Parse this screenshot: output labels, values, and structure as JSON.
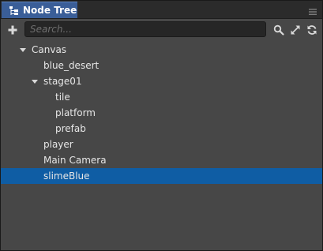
{
  "panel": {
    "tab_title": "Node Tree",
    "tab_icon": "node-tree-icon",
    "menu_icon": "hamburger-menu-icon"
  },
  "toolbar": {
    "add_icon": "plus-icon",
    "search_placeholder": "Search...",
    "search_value": "",
    "search_icon": "magnifier-icon",
    "expand_icon": "expand-arrows-icon",
    "refresh_icon": "refresh-icon"
  },
  "tree": {
    "nodes": [
      {
        "label": "Canvas",
        "depth": 0,
        "expanded": true,
        "has_children": true,
        "selected": false
      },
      {
        "label": "blue_desert",
        "depth": 1,
        "expanded": false,
        "has_children": false,
        "selected": false
      },
      {
        "label": "stage01",
        "depth": 1,
        "expanded": true,
        "has_children": true,
        "selected": false
      },
      {
        "label": "tile",
        "depth": 2,
        "expanded": false,
        "has_children": false,
        "selected": false
      },
      {
        "label": "platform",
        "depth": 2,
        "expanded": false,
        "has_children": false,
        "selected": false
      },
      {
        "label": "prefab",
        "depth": 2,
        "expanded": false,
        "has_children": false,
        "selected": false
      },
      {
        "label": "player",
        "depth": 1,
        "expanded": false,
        "has_children": false,
        "selected": false
      },
      {
        "label": "Main Camera",
        "depth": 1,
        "expanded": false,
        "has_children": false,
        "selected": false
      },
      {
        "label": "slimeBlue",
        "depth": 1,
        "expanded": false,
        "has_children": false,
        "selected": true
      }
    ]
  },
  "colors": {
    "panel_bg": "#474747",
    "tab_active": "#3a5e98",
    "selection": "#0f5da4",
    "text": "#e6e6e6"
  }
}
